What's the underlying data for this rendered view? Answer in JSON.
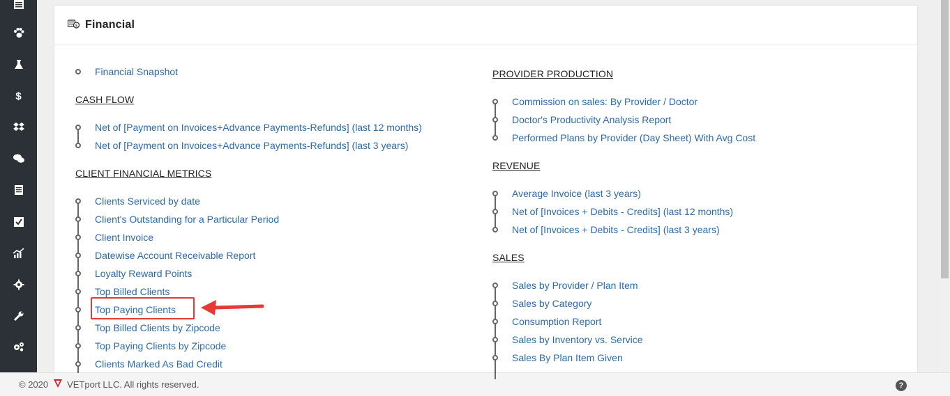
{
  "sidebar": {
    "items": [
      {
        "icon": "calendar-icon"
      },
      {
        "icon": "paw-icon"
      },
      {
        "icon": "flask-icon"
      },
      {
        "icon": "dollar-icon",
        "glyph": "$"
      },
      {
        "icon": "dropbox-icon"
      },
      {
        "icon": "chat-icon"
      },
      {
        "icon": "ledger-icon"
      },
      {
        "icon": "checkbox-icon"
      },
      {
        "icon": "growth-chart-icon"
      },
      {
        "icon": "gear-icon"
      },
      {
        "icon": "wrench-icon"
      },
      {
        "icon": "cogs-icon"
      }
    ]
  },
  "panel": {
    "title": "Financial",
    "icon": "money-icon"
  },
  "left": {
    "top_link": "Financial Snapshot",
    "cash_flow": {
      "heading": "CASH FLOW",
      "links": [
        "Net of [Payment on Invoices+Advance Payments-Refunds] (last 12 months)",
        "Net of [Payment on Invoices+Advance Payments-Refunds] (last 3 years)"
      ]
    },
    "client_metrics": {
      "heading": "CLIENT FINANCIAL METRICS",
      "links": [
        "Clients Serviced by date",
        "Client's Outstanding for a Particular Period",
        "Client Invoice",
        "Datewise Account Receivable Report",
        "Loyalty Reward Points",
        "Top Billed Clients",
        "Top Paying Clients",
        "Top Billed Clients by Zipcode",
        "Top Paying Clients by Zipcode",
        "Clients Marked As Bad Credit"
      ]
    }
  },
  "right": {
    "provider_production": {
      "heading": "PROVIDER PRODUCTION",
      "links": [
        "Commission on sales: By Provider / Doctor",
        "Doctor's Productivity Analysis Report",
        "Performed Plans by Provider (Day Sheet) With Avg Cost"
      ]
    },
    "revenue": {
      "heading": "REVENUE",
      "links": [
        "Average Invoice (last 3 years)",
        "Net of [Invoices + Debits - Credits] (last 12 months)",
        "Net of [Invoices + Debits - Credits] (last 3 years)"
      ]
    },
    "sales": {
      "heading": "SALES",
      "links": [
        "Sales by Provider / Plan Item",
        "Sales by Category",
        "Consumption Report",
        "Sales by Inventory vs. Service",
        "Sales By Plan Item Given"
      ]
    }
  },
  "footer": {
    "copyright": "© 2020",
    "company": "VETport LLC. All rights reserved.",
    "help": "?"
  },
  "annotation": {
    "highlight_color": "#e53935"
  }
}
